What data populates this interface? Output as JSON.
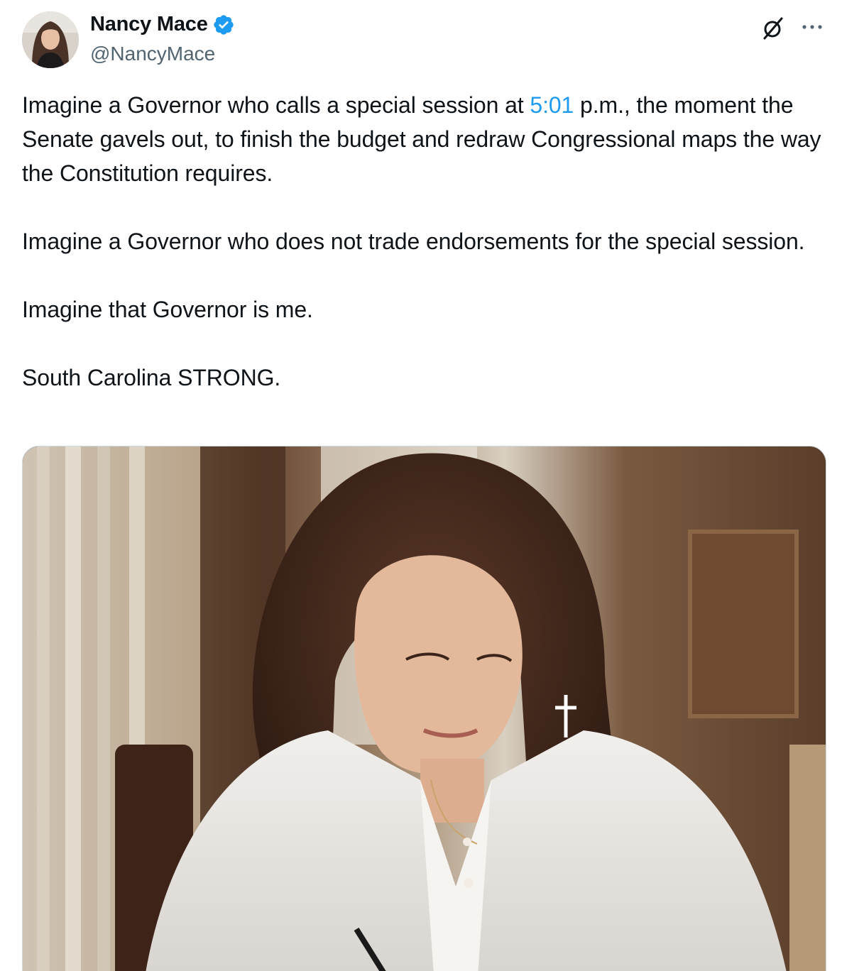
{
  "author": {
    "display_name": "Nancy Mace",
    "handle": "@NancyMace",
    "verified": true
  },
  "icons": {
    "verified": "verified-badge-icon",
    "grok": "grok-icon",
    "more": "more-options-icon"
  },
  "tweet": {
    "p1_before": "Imagine a Governor who calls a special session at ",
    "p1_link": "5:01",
    "p1_after": " p.m., the moment the Senate gavels out, to finish the budget and redraw Congressional maps the way the Constitution requires.",
    "p2": "Imagine a Governor who does not trade endorsements for the special session.",
    "p3": "Imagine that Governor is me.",
    "p4": "South Carolina STRONG."
  },
  "colors": {
    "link": "#1d9bf0",
    "verified": "#1d9bf0",
    "text": "#0f1419",
    "secondary": "#536471"
  }
}
